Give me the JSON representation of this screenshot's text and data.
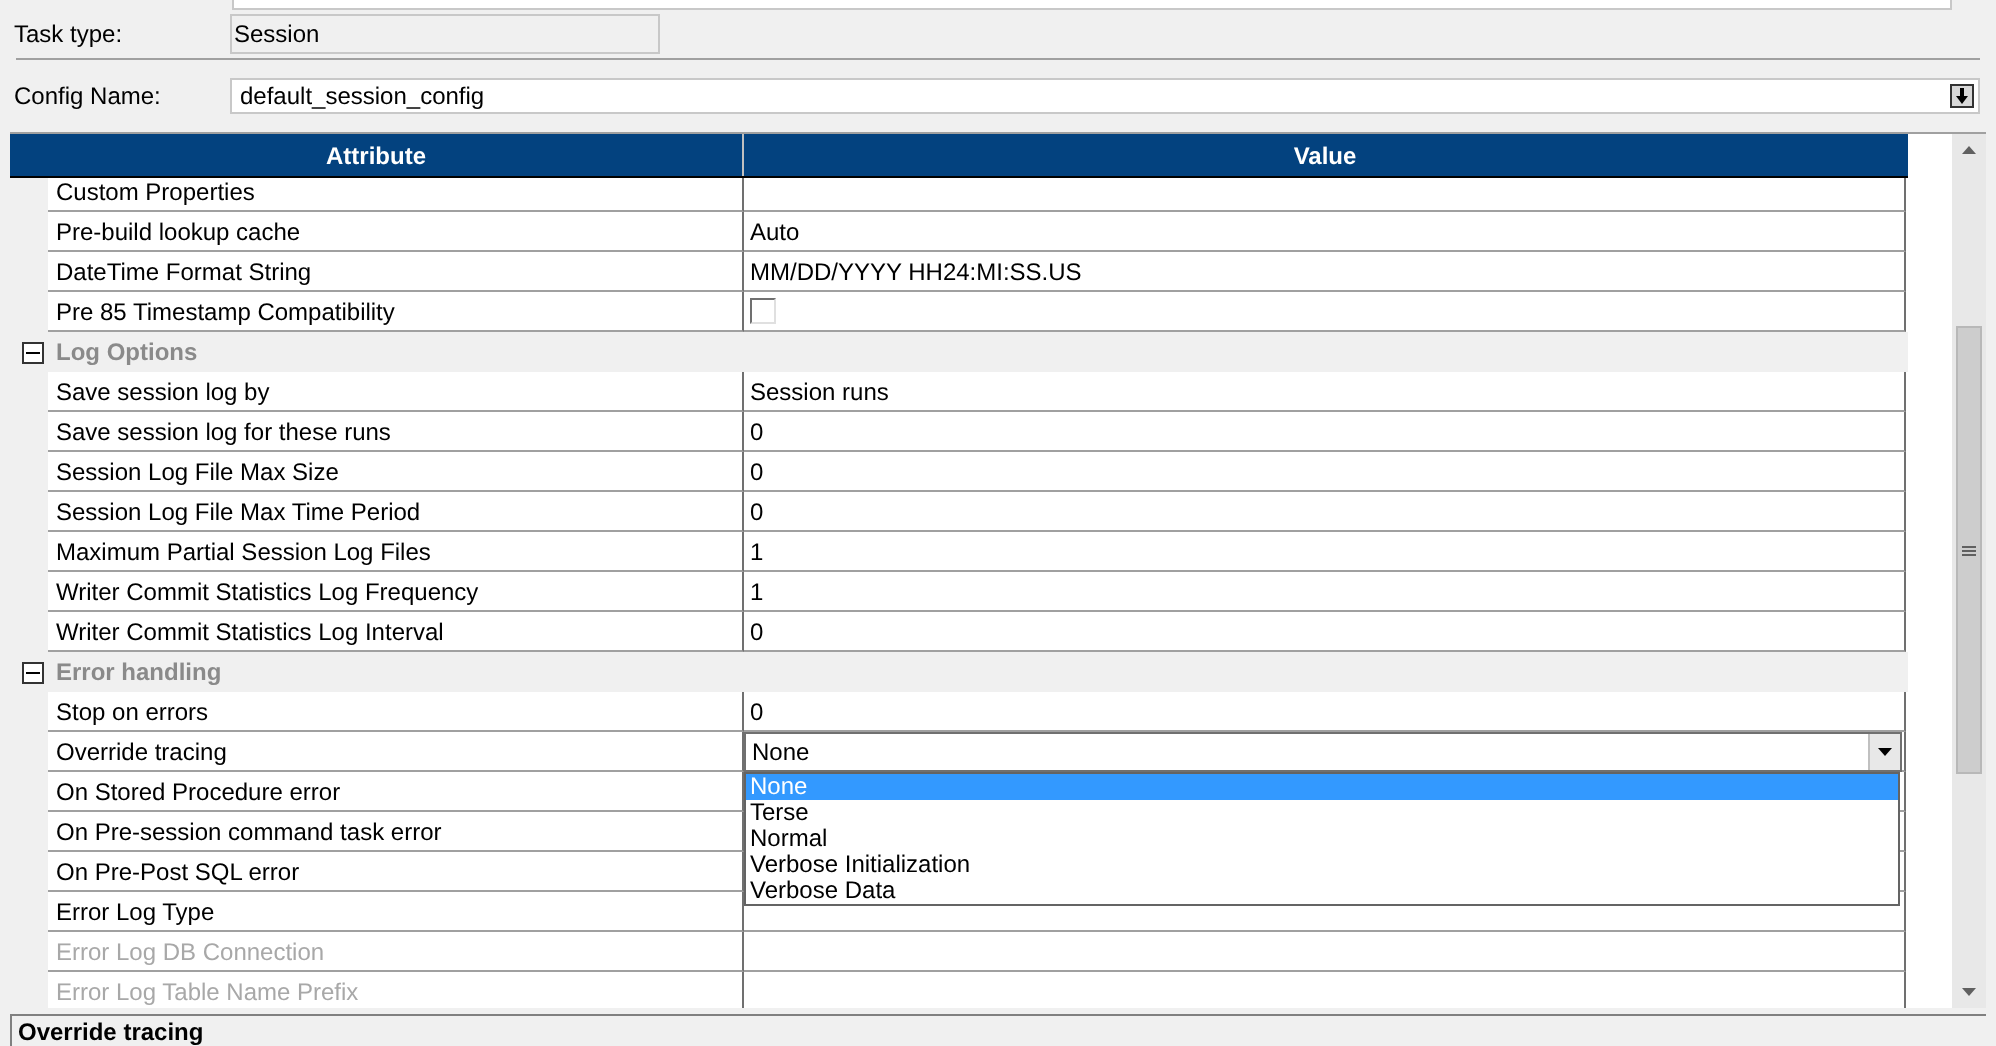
{
  "task_type": {
    "label": "Task type:",
    "value": "Session"
  },
  "config_name": {
    "label": "Config Name:",
    "value": "default_session_config"
  },
  "table": {
    "columns": [
      "Attribute",
      "Value"
    ],
    "rows": [
      {
        "kind": "property",
        "attribute": "Custom Properties"
      },
      {
        "kind": "property",
        "attribute": "Pre-build lookup cache",
        "value": "Auto"
      },
      {
        "kind": "property",
        "attribute": "DateTime Format String",
        "value": "MM/DD/YYYY HH24:MI:SS.US"
      },
      {
        "kind": "checkbox",
        "attribute": "Pre 85 Timestamp Compatibility",
        "checked": false
      },
      {
        "kind": "group",
        "attribute": "Log Options",
        "expanded": true
      },
      {
        "kind": "property",
        "attribute": "Save session log by",
        "value": "Session runs"
      },
      {
        "kind": "property",
        "attribute": "Save session log for these runs",
        "value": "0"
      },
      {
        "kind": "property",
        "attribute": "Session Log File Max Size",
        "value": "0"
      },
      {
        "kind": "property",
        "attribute": "Session Log File Max Time Period",
        "value": "0"
      },
      {
        "kind": "property",
        "attribute": "Maximum Partial Session Log Files",
        "value": "1"
      },
      {
        "kind": "property",
        "attribute": "Writer Commit Statistics Log Frequency",
        "value": "1"
      },
      {
        "kind": "property",
        "attribute": "Writer Commit Statistics Log Interval",
        "value": "0"
      },
      {
        "kind": "group",
        "attribute": "Error handling",
        "expanded": true
      },
      {
        "kind": "property",
        "attribute": "Stop on errors",
        "value": "0"
      },
      {
        "kind": "combo",
        "attribute": "Override tracing",
        "value": "None",
        "open": true,
        "options": [
          {
            "label": "None",
            "selected": true
          },
          {
            "label": "Terse",
            "selected": false
          },
          {
            "label": "Normal",
            "selected": false
          },
          {
            "label": "Verbose Initialization",
            "selected": false
          },
          {
            "label": "Verbose Data",
            "selected": false
          }
        ]
      },
      {
        "kind": "property",
        "attribute": "On Stored Procedure error"
      },
      {
        "kind": "property",
        "attribute": "On Pre-session command task error"
      },
      {
        "kind": "property",
        "attribute": "On Pre-Post SQL error"
      },
      {
        "kind": "property",
        "attribute": "Error Log Type"
      },
      {
        "kind": "property",
        "attribute": "Error Log DB Connection",
        "disabled": true
      },
      {
        "kind": "property",
        "attribute": "Error Log Table Name Prefix",
        "disabled": true
      }
    ]
  },
  "status_bar": {
    "text": "Override tracing"
  }
}
